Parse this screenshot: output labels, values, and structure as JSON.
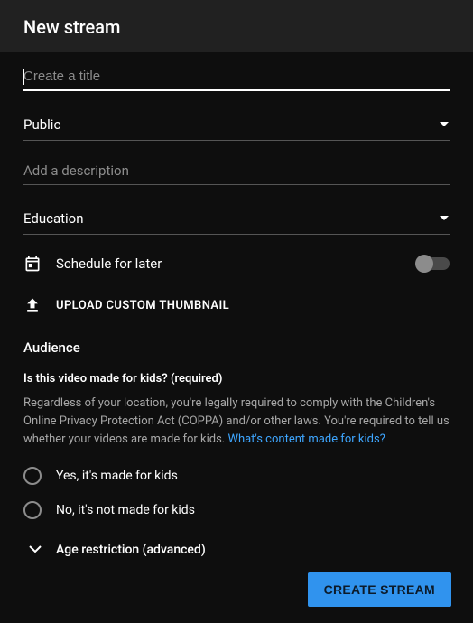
{
  "header": {
    "title": "New stream"
  },
  "title_field": {
    "placeholder": "Create a title",
    "value": ""
  },
  "visibility": {
    "selected": "Public"
  },
  "description": {
    "placeholder": "Add a description",
    "value": ""
  },
  "category": {
    "selected": "Education"
  },
  "schedule": {
    "label": "Schedule for later",
    "enabled": false
  },
  "upload_thumbnail": {
    "label": "UPLOAD CUSTOM THUMBNAIL"
  },
  "audience": {
    "section_title": "Audience",
    "question": "Is this video made for kids? (required)",
    "legal_text": "Regardless of your location, you're legally required to comply with the Children's Online Privacy Protection Act (COPPA) and/or other laws. You're required to tell us whether your videos are made for kids. ",
    "legal_link": "What's content made for kids?",
    "options": {
      "yes": "Yes, it's made for kids",
      "no": "No, it's not made for kids"
    },
    "age_restriction_label": "Age restriction (advanced)"
  },
  "footer": {
    "create_label": "CREATE STREAM"
  }
}
